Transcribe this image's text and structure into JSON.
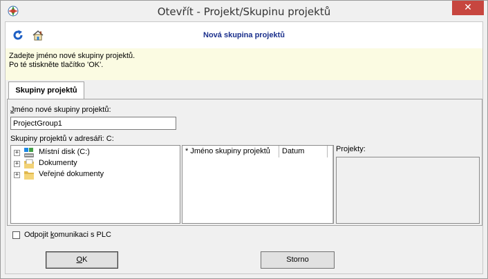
{
  "window": {
    "title": "Otevřít - Projekt/Skupinu projektů",
    "close_glyph": "✕"
  },
  "toolbar": {
    "icons": [
      "refresh-icon",
      "home-icon"
    ],
    "heading": "Nová skupina projektů"
  },
  "hint": {
    "line1": "Zadejte jméno nové skupiny projektů.",
    "line2": "Po té stiskněte tlačítko 'OK'."
  },
  "tab": {
    "label": "Skupiny projektů"
  },
  "form": {
    "name_label_prefix": "J",
    "name_label_rest": "méno nové skupiny projektů:",
    "name_value": "ProjectGroup1",
    "dir_label": "Skupiny projektů v adresáři:  C:",
    "projects_label": "Projekty:"
  },
  "tree": {
    "items": [
      {
        "label": "Místní disk (C:)",
        "icon": "drive-icon"
      },
      {
        "label": "Dokumenty",
        "icon": "documents-folder-icon"
      },
      {
        "label": "Veřejné dokumenty",
        "icon": "folder-icon"
      }
    ]
  },
  "list": {
    "columns": [
      "* Jméno skupiny projektů",
      "Datum"
    ]
  },
  "options": {
    "disconnect_prefix": "Odpojit ",
    "disconnect_underline": "k",
    "disconnect_rest": "omunikaci s PLC",
    "disconnect_checked": false
  },
  "buttons": {
    "ok_underline": "O",
    "ok_rest": "K",
    "cancel": "Storno"
  },
  "colors": {
    "heading": "#1a2f8c",
    "hint_bg": "#fbfbe2",
    "close_bg": "#c7463f"
  }
}
